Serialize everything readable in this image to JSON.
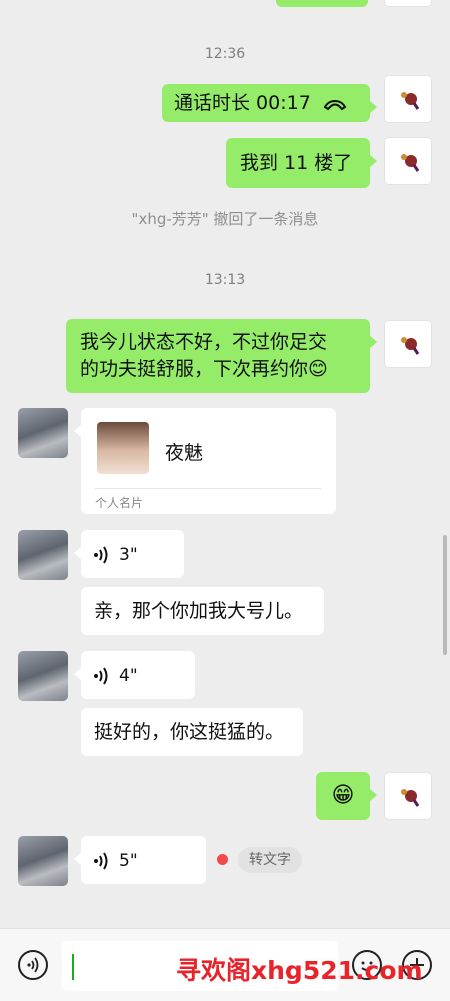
{
  "colors": {
    "self_bubble": "#95ec69",
    "peer_bubble": "#ffffff",
    "background": "#ededed",
    "watermark": "#e8232a"
  },
  "timestamps": [
    "12:36",
    "13:13"
  ],
  "messages": {
    "call_duration": "通话时长 00:17",
    "floor": "我到 11 楼了",
    "recall_notice": "\"xhg-芳芳\" 撤回了一条消息",
    "self_long_line1": "我今儿状态不好，不过你足交",
    "self_long_line2": "的功夫挺舒服，下次再约你😊",
    "contact_card_name": "夜魅",
    "contact_card_type": "个人名片",
    "voice1": "3\"",
    "peer_text1": "亲，那个你加我大号儿。",
    "voice2": "4\"",
    "peer_text2": "挺好的，你这挺猛的。",
    "self_emoji": "😁",
    "voice3": "5\"",
    "to_text": "转文字"
  },
  "watermark_text": "寻欢阁xhg521.com"
}
